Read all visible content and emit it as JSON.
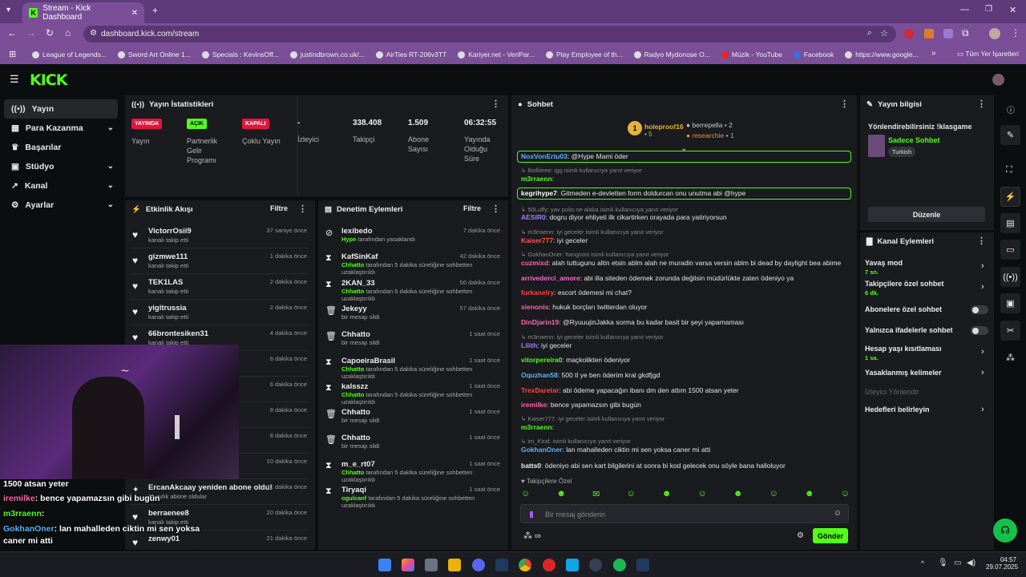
{
  "browser": {
    "tab_title": "Stream - Kick Dashboard",
    "url": "dashboard.kick.com/stream",
    "all_bookmarks": "Tüm Yer İşaretleri",
    "bookmarks": [
      "League of Legends...",
      "Sword Art Online 1...",
      "Specials : KevinsOff...",
      "justindbrown.co.uk/...",
      "AirTies RT-206v3TT",
      "Kariyer.net - VeriPar...",
      "Play Employee of th...",
      "Radyo Mydonose O...",
      "Müzik - YouTube",
      "Facebook",
      "https://www.google..."
    ]
  },
  "logo": "KICK",
  "sidebar": {
    "items": [
      {
        "label": "Yayın"
      },
      {
        "label": "Para Kazanma"
      },
      {
        "label": "Başarılar"
      },
      {
        "label": "Stüdyo"
      },
      {
        "label": "Kanal"
      },
      {
        "label": "Ayarlar"
      }
    ]
  },
  "stats": {
    "title": "Yayın İstatistikleri",
    "cells": [
      {
        "badge": "YAYINDA",
        "label": "Yayın"
      },
      {
        "badge": "AÇIK",
        "label": "Partnerlik Gelir Programı"
      },
      {
        "badge": "KAPALI",
        "label": "Çoklu Yayın"
      },
      {
        "value": "-",
        "label": "İzleyici"
      },
      {
        "value": "338.408",
        "label": "Takipçi"
      },
      {
        "value": "1.509",
        "label": "Abone Sayısı"
      },
      {
        "value": "06:32:55",
        "label": "Yayında Olduğu Süre"
      }
    ]
  },
  "activity": {
    "title": "Etkinlik Akışı",
    "filter": "Filtre",
    "items": [
      {
        "name": "VictorrOsii9",
        "sub": "kanalı takip etti",
        "time": "37 saniye önce"
      },
      {
        "name": "gizmwe111",
        "sub": "kanalı takip etti",
        "time": "1 dakika önce"
      },
      {
        "name": "TEK1LAS",
        "sub": "kanalı takip etti",
        "time": "2 dakika önce"
      },
      {
        "name": "yigitrussia",
        "sub": "kanalı takip etti",
        "time": "2 dakika önce"
      },
      {
        "name": "66brontesiken31",
        "sub": "kanalı takip etti",
        "time": "4 dakika önce"
      },
      {
        "name": "",
        "sub": "",
        "time": "6 dakika önce"
      },
      {
        "name": "",
        "sub": "",
        "time": "6 dakika önce"
      },
      {
        "name": "",
        "sub": "",
        "time": "8 dakika önce"
      },
      {
        "name": "",
        "sub": "",
        "time": "8 dakika önce"
      },
      {
        "name": "",
        "sub": "",
        "time": "10 dakika önce"
      },
      {
        "name": "ErcanAkcaay yeniden abone oldu!",
        "sub": "11 aylık abone oldular",
        "time": "11 dakika önce"
      },
      {
        "name": "berraenee8",
        "sub": "kanalı takip etti",
        "time": "20 dakika önce"
      },
      {
        "name": "zenwy01",
        "sub": "",
        "time": "21 dakika önce"
      }
    ]
  },
  "moderation": {
    "title": "Denetim Eylemleri",
    "filter": "Filtre",
    "items": [
      {
        "name": "lexibedo",
        "by": "Hype",
        "rest": " tarafından yasaklandı",
        "time": "7 dakika önce",
        "icon": "ban"
      },
      {
        "name": "KafSinKaf",
        "by": "Chhatto",
        "rest": " tarafından 5 dakika süreliğine sohbetten uzaklaştırıldı",
        "time": "42 dakika önce",
        "icon": "timer"
      },
      {
        "name": "2KAN_33",
        "by": "Chhatto",
        "rest": " tarafından 5 dakika süreliğine sohbetten uzaklaştırıldı",
        "time": "56 dakika önce",
        "icon": "timer"
      },
      {
        "name": "Jekeyy",
        "by": "",
        "rest": "bir mesajı sildi",
        "time": "57 dakika önce",
        "icon": "trash"
      },
      {
        "name": "Chhatto",
        "by": "",
        "rest": "bir mesajı sildi",
        "time": "1 saat önce",
        "icon": "trash"
      },
      {
        "name": "CapoeiraBrasil",
        "by": "Chhatto",
        "rest": " tarafından 5 dakika süreliğine sohbetten uzaklaştırıldı",
        "time": "1 saat önce",
        "icon": "timer"
      },
      {
        "name": "kalsszz",
        "by": "Chhatto",
        "rest": " tarafından 5 dakika süreliğine sohbetten uzaklaştırıldı",
        "time": "1 saat önce",
        "icon": "timer"
      },
      {
        "name": "Chhatto",
        "by": "",
        "rest": "bir mesajı sildi",
        "time": "1 saat önce",
        "icon": "trash"
      },
      {
        "name": "Chhatto",
        "by": "",
        "rest": "bir mesajı sildi",
        "time": "1 saat önce",
        "icon": "trash"
      },
      {
        "name": "m_e_rt07",
        "by": "Chhatto",
        "rest": " tarafından 5 dakika süreliğine sohbetten uzaklaştırıldı",
        "time": "1 saat önce",
        "icon": "timer"
      },
      {
        "name": "Tiryaqi",
        "by": "ogulcanf",
        "rest": " tarafından 5 dakika süreliğine sohbetten uzaklaştırıldı",
        "time": "1 saat önce",
        "icon": "timer"
      }
    ]
  },
  "chat": {
    "title": "Sohbet",
    "leaders": [
      {
        "name": "holeproof16",
        "count": "5",
        "rank": "1"
      },
      {
        "name": "berrepella",
        "count": "2"
      },
      {
        "name": "researchie",
        "count": "1"
      }
    ],
    "messages": [
      {
        "type": "hl",
        "user": "NoxVonErtu03",
        "color": "#5ab4ff",
        "text": "@Hype Mami öder"
      },
      {
        "type": "reply",
        "text": "lbolliieee: igg isimli kullanıcıya yanıt veriyor"
      },
      {
        "type": "msg",
        "user": "m3rraenn",
        "color": "#53fc18",
        "text": ""
      },
      {
        "type": "hl",
        "user": "kegrihype7",
        "color": "#ffffff",
        "text": "Gitmeden e-devletten form doldurcan onu unutma abi @hype"
      },
      {
        "type": "reply",
        "text": "50Luffy: yav polis ne alaka isimli kullanıcıya yanıt veriyor"
      },
      {
        "type": "msg",
        "user": "AESIR0",
        "color": "#a07cff",
        "text": "dogru diyor ehliyeti ilk cikartirken orayada para yatiriyorsun"
      },
      {
        "type": "reply",
        "text": "m3rraenn: iyi geceler isimli kullanıcıya yanıt veriyor"
      },
      {
        "type": "msg",
        "user": "Kaiser777",
        "color": "#ff5555",
        "text": "iyi geceler"
      },
      {
        "type": "reply",
        "text": "GokhanOner: hangisini isimli kullanıcıya yanıt veriyor"
      },
      {
        "type": "msg",
        "user": "cuzmixd",
        "color": "#ff66aa",
        "text": "alah tuttugunu altin etsin ablm alah ne muradin varsa versin ablm bi dead by daylight bea abime"
      },
      {
        "type": "msg",
        "user": "arrivederci_amore",
        "color": "#ff66cc",
        "text": "abi illa siteden ödemek zorunda değilsin müdürlükte zaten ödeniyo ya"
      },
      {
        "type": "msg",
        "user": "furkanelry",
        "color": "#ff4444",
        "text": "escort ödemesi mi chat?"
      },
      {
        "type": "msg",
        "user": "xienonis",
        "color": "#ff66aa",
        "text": "hukuk borçları twitterdan oluyor"
      },
      {
        "type": "msg",
        "user": "DinDjarin19",
        "color": "#ff66aa",
        "text": "@RyuuujinJakka sorma bu kadar basit bir şeyi yapamaması"
      },
      {
        "type": "reply",
        "text": "m3rraenn: iyi geceler isimli kullanıcıya yanıt veriyor"
      },
      {
        "type": "msg",
        "user": "Lilith",
        "color": "#a07cff",
        "text": "iyi geceler"
      },
      {
        "type": "msg",
        "user": "vitorpereira0",
        "color": "#53fc18",
        "text": "maçkolikten ödeniyor"
      },
      {
        "type": "msg",
        "user": "Oquzhan58",
        "color": "#5ab4ff",
        "text": "500 tl ye ben öderim kral gkdfjgd"
      },
      {
        "type": "msg",
        "user": "TrexDaretar",
        "color": "#ff4444",
        "text": "abi ödeme yapacağın ibanı dm den attım 1500 atsan yeter"
      },
      {
        "type": "msg",
        "user": "iremilke",
        "color": "#ff66aa",
        "text": "bence yapamazsın gibi bugün"
      },
      {
        "type": "reply",
        "text": "Kaiser777: iyi geceler isimli kullanıcıya yanıt veriyor"
      },
      {
        "type": "msg",
        "user": "m3rraenn",
        "color": "#53fc18",
        "text": ""
      },
      {
        "type": "reply",
        "text": "im_Kiral: isimli kullanıcıya yanıt veriyor"
      },
      {
        "type": "msg",
        "user": "GokhanOner",
        "color": "#5ab4ff",
        "text": "lan mahalleden ciktin mi sen yoksa caner mi atti"
      },
      {
        "type": "msg",
        "user": "batts0",
        "color": "#eeeeee",
        "text": "ödeniyo abi sen kart bilgilerini at sonra bi kod gelecek onu söyle bana halloluyor"
      }
    ],
    "followers_only": "Takipçilere Özel",
    "placeholder": "Bir mesaj gönderin",
    "send": "Gönder"
  },
  "stream_info": {
    "title": "Yayın bilgisi",
    "stream_title": "Yönlendirebilirsiniz !klasgame",
    "category": "Sadece Sohbet",
    "tag": "Turkish",
    "edit": "Düzenle"
  },
  "channel_actions": {
    "title": "Kanal Eylemleri",
    "items": [
      {
        "label": "Yavaş mod",
        "sub": "7 sn.",
        "kind": "chev"
      },
      {
        "label": "Takipçilere özel sohbet",
        "sub": "6 dk.",
        "kind": "chev"
      },
      {
        "label": "Abonelere özel sohbet",
        "sub": "",
        "kind": "toggle"
      },
      {
        "label": "Yalnızca ifadelerle sohbet",
        "sub": "",
        "kind": "toggle"
      },
      {
        "label": "Hesap yaşı kısıtlaması",
        "sub": "1 sa.",
        "kind": "chev"
      },
      {
        "label": "Yasaklanmış kelimeler",
        "sub": "",
        "kind": "chev"
      },
      {
        "label": "İzleyici Yönlendir",
        "sub": "",
        "kind": "disabled"
      },
      {
        "label": "Hedefleri belirleyin",
        "sub": "",
        "kind": "chev"
      }
    ]
  },
  "overlay": {
    "lines": [
      {
        "user": "",
        "text": "1500 atsan yeter",
        "color": "#fff"
      },
      {
        "user": "iremilke",
        "text": ": bence yapamazsın gibi bugün",
        "color": "#ff66aa"
      },
      {
        "user": "m3rraenn",
        "text": ":",
        "color": "#53fc18"
      },
      {
        "user": "GokhanOner",
        "text": ": lan mahalleden ciktin mi sen yoksa",
        "color": "#5ab4ff"
      },
      {
        "user": "",
        "text": "caner mi atti",
        "color": "#fff"
      },
      {
        "user": "batts0",
        "text": ": ödeniyo abi sen kart bilgilerini at sonra bi kod",
        "color": "#fff"
      },
      {
        "user": "",
        "text": "gelecek onu söyle bana halloluyor",
        "color": "#fff"
      }
    ]
  },
  "taskbar": {
    "time": "04:57",
    "date": "29.07.2025"
  },
  "colors": {
    "accent": "#53fc18",
    "live": "#e0163c"
  }
}
